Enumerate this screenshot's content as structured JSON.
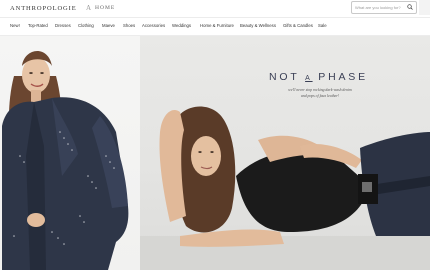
{
  "header": {
    "logo": "ANTHROPOLOGIE",
    "logo_separator": "A",
    "logo_sub": "HOME",
    "search_placeholder": "What are you looking for?",
    "search_icon": "search-icon"
  },
  "nav": {
    "items": [
      "New!",
      "Top-Rated",
      "Dresses",
      "Clothing",
      "Maeve",
      "Shoes",
      "Accessories",
      "Weddings",
      "Home & Furniture",
      "Beauty & Wellness",
      "Gifts & Candles",
      "Sale"
    ]
  },
  "hero": {
    "headline_part1": "NOT ",
    "headline_part2": "A",
    "headline_part3": " PHASE",
    "subline_1": "we'll never stop rocking dark-wash denim",
    "subline_2": "and pops of faux leather!"
  },
  "colors": {
    "headline": "#3a3f55",
    "denim": "#2c3344",
    "top": "#1a1a1a"
  }
}
